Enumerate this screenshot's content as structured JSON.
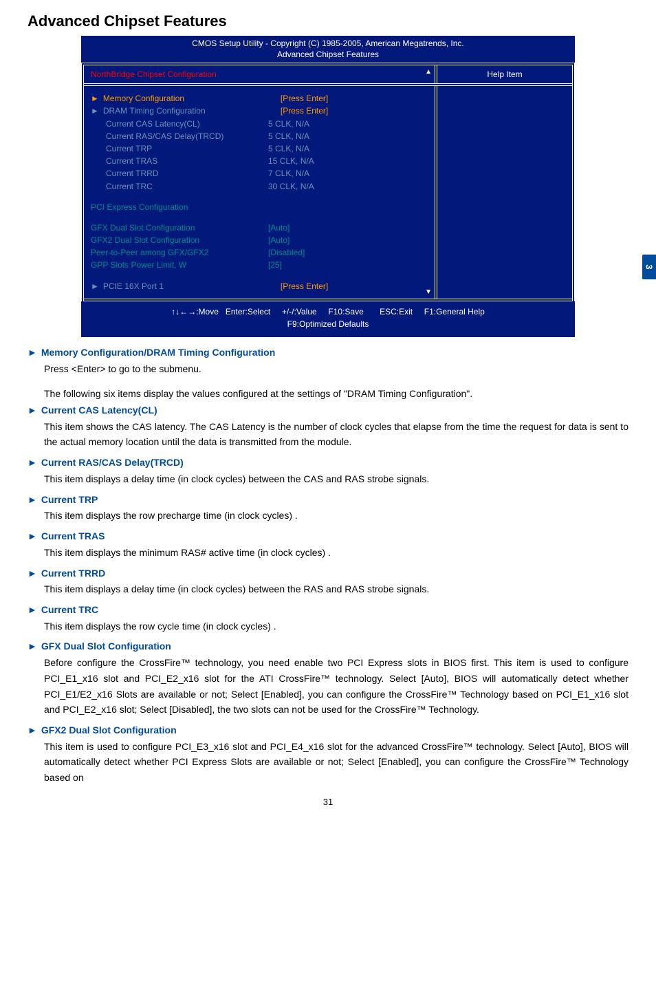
{
  "section_title": "Advanced Chipset Features",
  "bios": {
    "title_line1": "CMOS Setup Utility - Copyright (C) 1985-2005, American Megatrends, Inc.",
    "title_line2": "Advanced Chipset Features",
    "header_left": "NorthBridge Chipset Configuration",
    "header_right": "Help Item",
    "rows": {
      "mem_cfg": "Memory Configuration",
      "mem_cfg_val": "[Press Enter]",
      "dram": "DRAM Timing Configuration",
      "dram_val": "[Press Enter]",
      "cas": "Current CAS Latency(CL)",
      "cas_val": "5 CLK, N/A",
      "rastrcd": "Current RAS/CAS Delay(TRCD)",
      "rastrcd_val": "5 CLK, N/A",
      "trp": "Current TRP",
      "trp_val": "5 CLK, N/A",
      "tras": "Current TRAS",
      "tras_val": "15 CLK, N/A",
      "trrd": "Current TRRD",
      "trrd_val": "7 CLK, N/A",
      "trc": "Current TRC",
      "trc_val": "30 CLK, N/A",
      "pci_exp": "PCI Express Configuration",
      "gfx": "GFX Dual Slot Configuration",
      "gfx_val": "[Auto]",
      "gfx2": "GFX2 Dual Slot Configuration",
      "gfx2_val": "[Auto]",
      "peer": "Peer-to-Peer among GFX/GFX2",
      "peer_val": "[Disabled]",
      "gpp": "GPP Slots Power Limit, W",
      "gpp_val": "[25]",
      "pcie": "PCIE 16X Port 1",
      "pcie_val": "[Press Enter]"
    },
    "footer_line1": "↑↓←→:Move   Enter:Select     +/-/:Value     F10:Save       ESC:Exit     F1:General Help",
    "footer_line2": "F9:Optimized Defaults"
  },
  "descriptions": {
    "memcfg_title": "Memory Configuration/DRAM Timing Configuration",
    "memcfg_text": "Press <Enter> to go to the submenu.",
    "lead_text": "The following six items display the values configured at the settings of \"DRAM Timing Configuration\".",
    "cas_title": "Current CAS Latency(CL)",
    "cas_text": "This item shows the CAS latency. The CAS Latency is the number of clock cycles that elapse from the time the request for data is sent to the actual memory location until the data is transmitted from the module.",
    "rascas_title": "Current RAS/CAS Delay(TRCD)",
    "rascas_text": "This item displays a delay time (in clock cycles) between the CAS and RAS strobe signals.",
    "trp_title": "Current TRP",
    "trp_text": "This item displays the row precharge time (in clock cycles) .",
    "tras_title": "Current TRAS",
    "tras_text": "This item displays the minimum RAS# active time (in clock cycles) .",
    "trrd_title": "Current TRRD",
    "trrd_text": "This item displays a delay time (in clock cycles) between the RAS and RAS strobe signals.",
    "trc_title": "Current TRC",
    "trc_text": "This item displays the row cycle time (in clock cycles) .",
    "gfx_title": "GFX Dual Slot Configuration",
    "gfx_text": "Before configure the CrossFire™ technology, you need enable two PCI Express slots in BIOS first. This item is used to configure PCI_E1_x16 slot and PCI_E2_x16 slot for the ATI CrossFire™ technology. Select [Auto], BIOS will automatically detect whether PCI_E1/E2_x16 Slots are available or not; Select [Enabled], you can configure the CrossFire™ Technology based on PCI_E1_x16 slot and PCI_E2_x16 slot; Select [Disabled], the two slots can not be used for the CrossFire™ Technology.",
    "gfx2_title": "GFX2 Dual Slot Configuration",
    "gfx2_text": "This item is used to configure PCI_E3_x16 slot and PCI_E4_x16 slot for the advanced CrossFire™ technology. Select [Auto], BIOS will automatically detect whether PCI Express Slots are available or not; Select [Enabled], you can configure the CrossFire™ Technology based on"
  },
  "page_tab": "3",
  "page_number": "31"
}
